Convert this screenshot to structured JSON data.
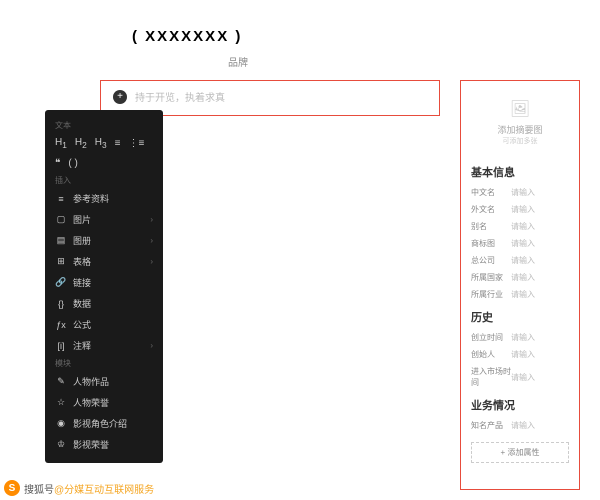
{
  "title": "( XXXXXXX )",
  "subtitle": "品牌",
  "mainInput": "持于开览，执着求真",
  "toolbar": {
    "textLabel": "文本",
    "quote": "❝",
    "paren": "( )",
    "insertLabel": "插入",
    "items": [
      {
        "icon": "≡",
        "label": "参考资料",
        "arrow": false
      },
      {
        "icon": "▢",
        "label": "图片",
        "arrow": true
      },
      {
        "icon": "▤",
        "label": "图册",
        "arrow": true
      },
      {
        "icon": "⊞",
        "label": "表格",
        "arrow": true
      },
      {
        "icon": "🔗",
        "label": "链接",
        "arrow": false
      },
      {
        "icon": "{}",
        "label": "数据",
        "arrow": false
      },
      {
        "icon": "ƒx",
        "label": "公式",
        "arrow": false
      },
      {
        "icon": "[i]",
        "label": "注释",
        "arrow": true
      }
    ],
    "moduleLabel": "模块",
    "modules": [
      {
        "icon": "✎",
        "label": "人物作品"
      },
      {
        "icon": "☆",
        "label": "人物荣誉"
      },
      {
        "icon": "◉",
        "label": "影视角色介绍"
      },
      {
        "icon": "♔",
        "label": "影视荣誉"
      }
    ]
  },
  "sidebar": {
    "imgText": "添加摘要图",
    "imgSub": "可添加多张",
    "basicInfo": "基本信息",
    "fields1": [
      {
        "lbl": "中文名",
        "val": "请输入"
      },
      {
        "lbl": "外文名",
        "val": "请输入"
      },
      {
        "lbl": "别名",
        "val": "请输入"
      },
      {
        "lbl": "商标图",
        "val": "请输入"
      },
      {
        "lbl": "总公司",
        "val": "请输入"
      },
      {
        "lbl": "所属国家",
        "val": "请输入"
      },
      {
        "lbl": "所属行业",
        "val": "请输入"
      }
    ],
    "history": "历史",
    "fields2": [
      {
        "lbl": "创立时间",
        "val": "请输入"
      },
      {
        "lbl": "创始人",
        "val": "请输入"
      },
      {
        "lbl": "进入市场时间",
        "val": "请输入"
      }
    ],
    "business": "业务情况",
    "fields3": [
      {
        "lbl": "知名产品",
        "val": "请输入"
      }
    ],
    "addAttr": "+ 添加属性"
  },
  "watermark": {
    "logo": "S",
    "text1": "搜狐号",
    "text2": "@分媒互动互联网服务"
  }
}
